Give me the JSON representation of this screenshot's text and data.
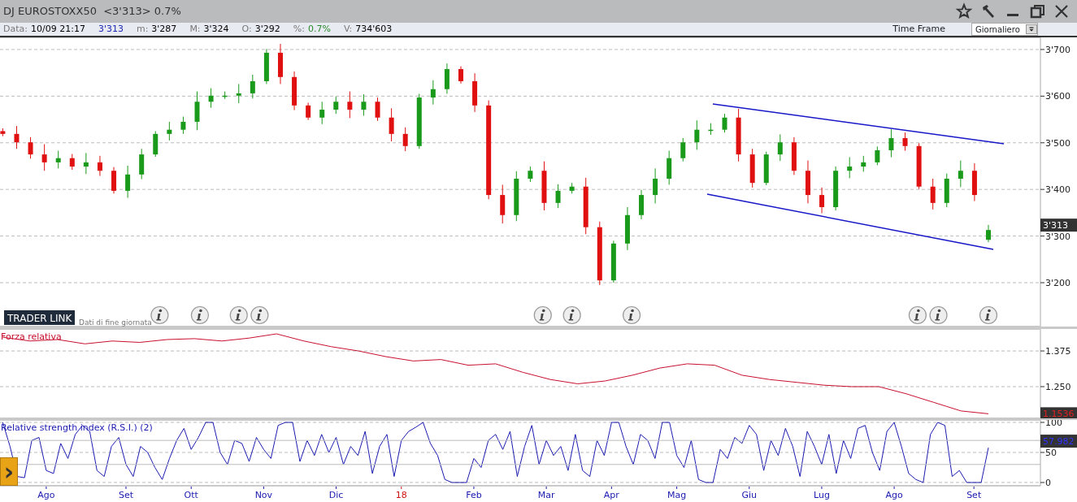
{
  "window": {
    "title": "DJ EUROSTOXX50  <3'313> 0.7%"
  },
  "info_bar": [
    {
      "label": "Data:",
      "value": "10/09 21:17",
      "color": "#000000"
    },
    {
      "value": "3'313",
      "color": "#1c2ab0"
    },
    {
      "label": "m:",
      "value": "3'287",
      "color": "#000000"
    },
    {
      "label": "M:",
      "value": "3'324",
      "color": "#000000"
    },
    {
      "label": "O:",
      "value": "3'292",
      "color": "#000000"
    },
    {
      "label": "%:",
      "value": "0.7%",
      "color": "#2a8a2a"
    },
    {
      "label": "V:",
      "value": "734'603",
      "color": "#000000"
    }
  ],
  "time_frame": {
    "label": "Time Frame",
    "value": "Giornaliero"
  },
  "price_panel": {
    "logo": "TRADER LINK",
    "note": "Dati di fine giornata",
    "last_price": "3'313",
    "chart_data": {
      "type": "candlestick",
      "grid": true,
      "ylim": [
        3106,
        3726
      ],
      "categories": [
        null,
        null,
        null,
        null,
        null,
        null,
        null,
        null,
        null,
        null,
        null,
        null,
        null,
        null,
        null,
        null,
        null,
        null,
        null,
        null,
        null,
        null,
        null,
        null,
        null,
        null,
        null,
        null,
        null,
        null,
        null,
        null,
        null,
        null,
        null,
        null,
        null,
        null,
        null,
        null,
        null,
        null,
        null,
        null,
        null,
        null,
        null,
        null,
        null,
        null,
        null,
        null,
        null,
        null,
        null,
        null,
        null,
        null,
        null,
        null,
        null,
        null,
        null,
        null,
        null,
        null,
        null,
        null,
        null,
        null,
        null,
        null
      ],
      "yticks": [
        {
          "value": 3200,
          "label": "3'200"
        },
        {
          "value": 3300,
          "label": "3'300"
        },
        {
          "value": 3400,
          "label": "3'400"
        },
        {
          "value": 3500,
          "label": "3'500"
        },
        {
          "value": 3600,
          "label": "3'600"
        },
        {
          "value": 3700,
          "label": "3'700"
        }
      ],
      "ohlc": [
        [
          3525,
          3531,
          3514,
          3519
        ],
        [
          3519,
          3536,
          3487,
          3501
        ],
        [
          3501,
          3512,
          3466,
          3475
        ],
        [
          3475,
          3497,
          3440,
          3458
        ],
        [
          3458,
          3483,
          3445,
          3467
        ],
        [
          3467,
          3476,
          3442,
          3449
        ],
        [
          3449,
          3478,
          3433,
          3458
        ],
        [
          3458,
          3472,
          3429,
          3440
        ],
        [
          3440,
          3448,
          3391,
          3397
        ],
        [
          3397,
          3451,
          3382,
          3432
        ],
        [
          3432,
          3487,
          3422,
          3475
        ],
        [
          3475,
          3525,
          3470,
          3519
        ],
        [
          3519,
          3545,
          3505,
          3528
        ],
        [
          3528,
          3556,
          3519,
          3545
        ],
        [
          3545,
          3610,
          3527,
          3588
        ],
        [
          3588,
          3617,
          3575,
          3601
        ],
        [
          3601,
          3610,
          3594,
          3601
        ],
        [
          3601,
          3626,
          3585,
          3606
        ],
        [
          3606,
          3646,
          3595,
          3632
        ],
        [
          3632,
          3701,
          3626,
          3693
        ],
        [
          3693,
          3712,
          3626,
          3641
        ],
        [
          3641,
          3653,
          3570,
          3580
        ],
        [
          3580,
          3586,
          3549,
          3554
        ],
        [
          3554,
          3588,
          3540,
          3571
        ],
        [
          3571,
          3599,
          3562,
          3588
        ],
        [
          3588,
          3610,
          3553,
          3571
        ],
        [
          3571,
          3604,
          3558,
          3588
        ],
        [
          3588,
          3597,
          3547,
          3554
        ],
        [
          3554,
          3574,
          3503,
          3519
        ],
        [
          3519,
          3533,
          3482,
          3493
        ],
        [
          3493,
          3605,
          3487,
          3597
        ],
        [
          3597,
          3634,
          3582,
          3615
        ],
        [
          3615,
          3670,
          3605,
          3658
        ],
        [
          3658,
          3664,
          3627,
          3632
        ],
        [
          3632,
          3649,
          3566,
          3580
        ],
        [
          3580,
          3591,
          3379,
          3388
        ],
        [
          3388,
          3410,
          3327,
          3345
        ],
        [
          3345,
          3439,
          3332,
          3423
        ],
        [
          3423,
          3449,
          3416,
          3440
        ],
        [
          3440,
          3460,
          3355,
          3371
        ],
        [
          3371,
          3411,
          3360,
          3397
        ],
        [
          3397,
          3414,
          3391,
          3406
        ],
        [
          3406,
          3425,
          3304,
          3319
        ],
        [
          3319,
          3331,
          3195,
          3205
        ],
        [
          3205,
          3290,
          3200,
          3284
        ],
        [
          3284,
          3362,
          3270,
          3345
        ],
        [
          3345,
          3399,
          3336,
          3388
        ],
        [
          3388,
          3445,
          3370,
          3423
        ],
        [
          3423,
          3483,
          3410,
          3467
        ],
        [
          3467,
          3510,
          3460,
          3501
        ],
        [
          3501,
          3548,
          3485,
          3528
        ],
        [
          3528,
          3542,
          3517,
          3528
        ],
        [
          3528,
          3562,
          3522,
          3554
        ],
        [
          3554,
          3573,
          3460,
          3475
        ],
        [
          3475,
          3487,
          3404,
          3414
        ],
        [
          3414,
          3481,
          3409,
          3475
        ],
        [
          3475,
          3518,
          3461,
          3501
        ],
        [
          3501,
          3512,
          3431,
          3440
        ],
        [
          3440,
          3462,
          3370,
          3388
        ],
        [
          3388,
          3404,
          3349,
          3362
        ],
        [
          3362,
          3449,
          3355,
          3440
        ],
        [
          3440,
          3469,
          3424,
          3449
        ],
        [
          3449,
          3472,
          3438,
          3458
        ],
        [
          3458,
          3492,
          3452,
          3484
        ],
        [
          3484,
          3529,
          3469,
          3510
        ],
        [
          3510,
          3522,
          3483,
          3493
        ],
        [
          3493,
          3499,
          3401,
          3406
        ],
        [
          3406,
          3423,
          3357,
          3371
        ],
        [
          3371,
          3434,
          3362,
          3423
        ],
        [
          3423,
          3462,
          3405,
          3440
        ],
        [
          3440,
          3456,
          3375,
          3388
        ],
        [
          3292,
          3324,
          3287,
          3313
        ]
      ]
    }
  },
  "relative_strength_panel": {
    "title": "Forza relativa",
    "last_value": "1.1536",
    "chart_data": {
      "type": "line",
      "grid": true,
      "ylim": [
        1.139,
        1.452
      ],
      "categories": [
        null,
        null,
        null,
        null,
        null,
        null,
        null,
        null,
        null,
        null,
        null,
        null,
        null,
        null,
        null,
        null,
        null,
        null,
        null,
        null,
        null,
        null,
        null,
        null,
        null,
        null,
        null,
        null,
        null,
        null,
        null,
        null,
        null,
        null,
        null,
        null,
        null
      ],
      "yticks": [
        {
          "value": 1.25,
          "label": "1.250"
        },
        {
          "value": 1.375,
          "label": "1.375"
        }
      ],
      "series": [
        {
          "color": "#c8102e",
          "values": [
            1.423,
            1.41,
            1.415,
            1.4,
            1.41,
            1.405,
            1.415,
            1.418,
            1.41,
            1.42,
            1.435,
            1.41,
            1.39,
            1.375,
            1.355,
            1.34,
            1.345,
            1.325,
            1.33,
            1.3,
            1.275,
            1.26,
            1.27,
            1.29,
            1.315,
            1.33,
            1.325,
            1.29,
            1.275,
            1.265,
            1.255,
            1.25,
            1.25,
            1.225,
            1.195,
            1.165,
            1.155
          ]
        }
      ]
    }
  },
  "rsi_panel": {
    "title": "Relative strength index (R.S.I.) (2)",
    "last_value": "57.982",
    "chart_data": {
      "type": "line",
      "grid": true,
      "ylim": [
        -5.41,
        104.05
      ],
      "categories": [
        null,
        null,
        null,
        null,
        null,
        null,
        "Ago",
        null,
        null,
        null,
        null,
        null,
        null,
        null,
        null,
        null,
        null,
        "Set",
        null,
        null,
        null,
        null,
        null,
        null,
        null,
        null,
        "Ott",
        null,
        null,
        null,
        null,
        null,
        null,
        null,
        null,
        null,
        "Nov",
        null,
        null,
        null,
        null,
        null,
        null,
        null,
        null,
        null,
        "Dic",
        null,
        null,
        null,
        null,
        null,
        null,
        null,
        null,
        null,
        null,
        null,
        null,
        null,
        null,
        null,
        null,
        null,
        null,
        "Feb",
        null,
        null,
        null,
        null,
        null,
        null,
        null,
        null,
        null,
        "Mar",
        null,
        null,
        null,
        null,
        null,
        null,
        null,
        null,
        "Apr",
        null,
        null,
        null,
        null,
        null,
        null,
        null,
        null,
        "Mag",
        null,
        null,
        null,
        null,
        null,
        null,
        null,
        null,
        null,
        "Giu",
        null,
        null,
        null,
        null,
        null,
        null,
        null,
        null,
        null,
        "Lug",
        null,
        null,
        null,
        null,
        null,
        null,
        null,
        null,
        null,
        "Ago",
        null,
        null,
        null,
        null,
        null,
        null,
        null,
        null,
        null,
        null,
        "Set",
        null,
        null
      ],
      "yticks": [
        {
          "value": 0,
          "label": "0"
        },
        {
          "value": 50,
          "label": "50"
        },
        {
          "value": 100,
          "label": "100"
        }
      ],
      "series": [
        {
          "color": "#1a1ab0",
          "values": [
            100,
            60,
            10,
            8,
            70,
            75,
            20,
            15,
            65,
            40,
            80,
            95,
            85,
            20,
            10,
            60,
            75,
            30,
            10,
            60,
            50,
            25,
            5,
            40,
            70,
            90,
            55,
            75,
            100,
            100,
            50,
            30,
            70,
            65,
            35,
            75,
            55,
            40,
            95,
            100,
            100,
            35,
            70,
            45,
            80,
            50,
            75,
            30,
            60,
            45,
            85,
            15,
            60,
            80,
            10,
            70,
            85,
            92,
            100,
            65,
            45,
            5,
            0,
            0,
            0,
            40,
            25,
            70,
            80,
            55,
            85,
            10,
            60,
            95,
            30,
            70,
            45,
            60,
            20,
            80,
            20,
            10,
            70,
            45,
            100,
            100,
            60,
            30,
            80,
            70,
            40,
            100,
            100,
            45,
            25,
            70,
            5,
            0,
            0,
            55,
            40,
            75,
            65,
            95,
            80,
            20,
            70,
            45,
            90,
            60,
            10,
            85,
            60,
            30,
            80,
            15,
            70,
            40,
            90,
            95,
            50,
            20,
            85,
            100,
            60,
            15,
            5,
            0,
            80,
            100,
            95,
            10,
            20,
            0,
            0,
            0,
            58
          ]
        }
      ]
    }
  },
  "year_marker": "18",
  "buttons": {
    "expand": "›"
  }
}
